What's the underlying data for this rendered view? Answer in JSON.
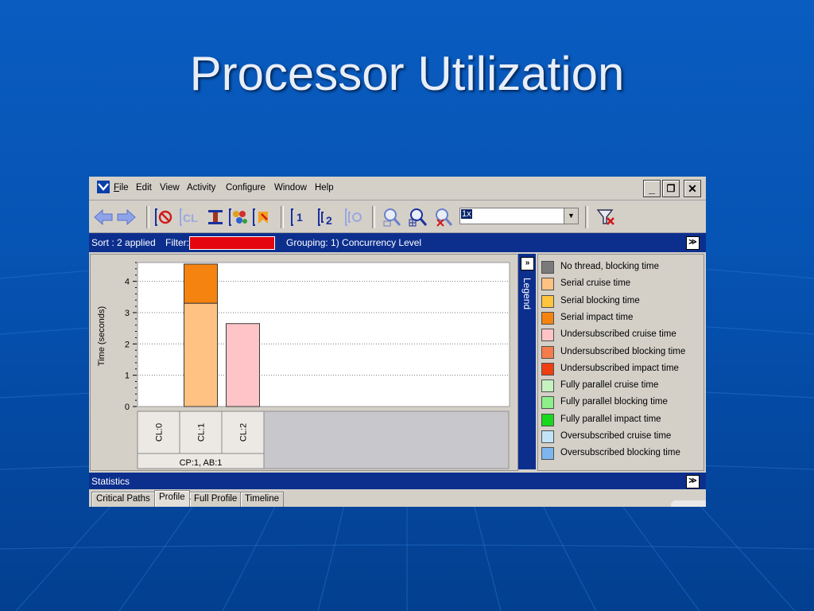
{
  "slide": {
    "title": "Processor Utilization"
  },
  "window": {
    "menu": [
      "File",
      "Edit",
      "View",
      "Activity",
      "Configure",
      "Window",
      "Help"
    ],
    "controls": {
      "minimize": "_",
      "restore": "❐",
      "close": "✕"
    }
  },
  "toolbar": {
    "icons": [
      "back-arrow-icon",
      "forward-arrow-icon",
      "no-entry-icon",
      "cl-bracket-icon",
      "column-icon",
      "threads-icon",
      "bookmark-icon",
      "bracket-1-icon",
      "bracket-2-icon",
      "bracket-refresh-icon",
      "zoom-out-icon",
      "zoom-in-icon",
      "zoom-reset-icon",
      "filter-clear-icon"
    ],
    "zoom_value": "1x"
  },
  "infobar": {
    "sort": "Sort : 2 applied",
    "filter_label": "Filter:",
    "grouping": "Grouping: 1) Concurrency Level",
    "filter_color": "#e4050f"
  },
  "chart_data": {
    "type": "bar",
    "stacked": true,
    "ylabel": "Time (seconds)",
    "ylim": [
      0,
      4.6
    ],
    "yticks": [
      "0",
      "1",
      "2",
      "3",
      "4"
    ],
    "categories": [
      "CL:0",
      "CL:1",
      "CL:2"
    ],
    "group_label": "CP:1, AB:1",
    "series": [
      {
        "name": "Serial cruise time",
        "color": "#ffc283",
        "values": [
          0,
          3.3,
          0
        ]
      },
      {
        "name": "Serial impact time",
        "color": "#f5830f",
        "values": [
          0,
          1.25,
          0
        ]
      },
      {
        "name": "Undersubscribed cruise time",
        "color": "#ffc4c8",
        "values": [
          0,
          0,
          2.65
        ]
      }
    ],
    "grid": true
  },
  "legend": {
    "tab_label": "Legend",
    "items": [
      {
        "label": "No thread, blocking time",
        "color": "#7a7a7a"
      },
      {
        "label": "Serial cruise time",
        "color": "#ffc283"
      },
      {
        "label": "Serial blocking time",
        "color": "#ffc43d"
      },
      {
        "label": "Serial impact time",
        "color": "#f5830f"
      },
      {
        "label": "Undersubscribed cruise time",
        "color": "#ffc4c8"
      },
      {
        "label": "Undersubscribed blocking time",
        "color": "#f57c4d"
      },
      {
        "label": "Undersubscribed impact time",
        "color": "#ef3f10"
      },
      {
        "label": "Fully parallel cruise time",
        "color": "#c6f2c0"
      },
      {
        "label": "Fully parallel blocking time",
        "color": "#8df08a"
      },
      {
        "label": "Fully parallel impact time",
        "color": "#1ad81c"
      },
      {
        "label": "Oversubscribed cruise time",
        "color": "#c2e2f8"
      },
      {
        "label": "Oversubscribed blocking time",
        "color": "#7db6ee"
      }
    ]
  },
  "statistics": {
    "title": "Statistics",
    "tabs": [
      "Critical Paths",
      "Profile",
      "Full Profile",
      "Timeline"
    ],
    "active_tab": "Profile"
  }
}
